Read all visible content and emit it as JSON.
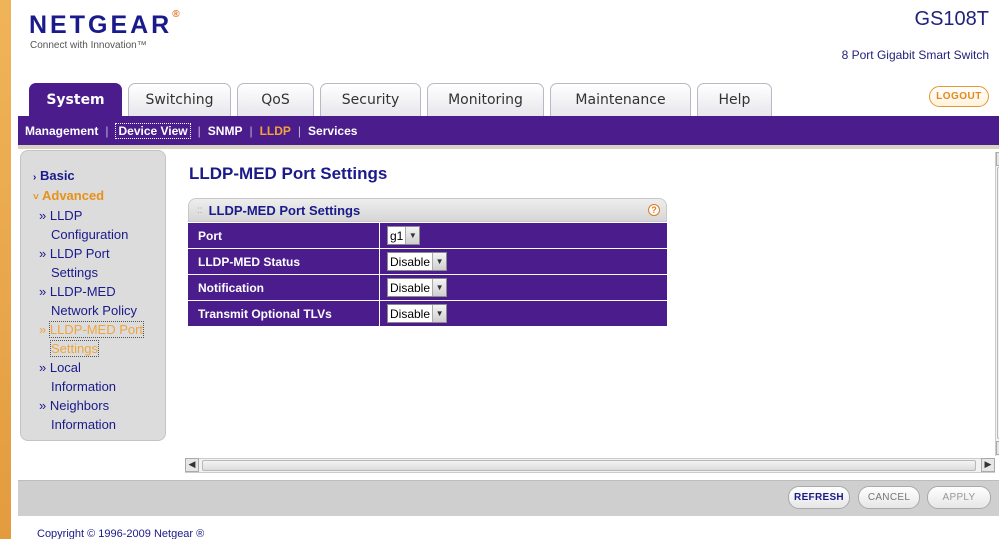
{
  "header": {
    "logo": "NETGEAR",
    "logo_mark": "®",
    "tagline": "Connect with Innovation™",
    "model": "GS108T",
    "model_desc": "8 Port Gigabit Smart Switch",
    "logout": "LOGOUT"
  },
  "tabs": [
    {
      "label": "System",
      "active": true
    },
    {
      "label": "Switching",
      "active": false
    },
    {
      "label": "QoS",
      "active": false
    },
    {
      "label": "Security",
      "active": false
    },
    {
      "label": "Monitoring",
      "active": false
    },
    {
      "label": "Maintenance",
      "active": false
    },
    {
      "label": "Help",
      "active": false
    }
  ],
  "subnav": [
    "Management",
    "Device View",
    "SNMP",
    "LLDP",
    "Services"
  ],
  "sidebar": {
    "basic": "Basic",
    "advanced": "Advanced",
    "items": [
      {
        "line1": "LLDP",
        "line2": "Configuration"
      },
      {
        "line1": "LLDP Port",
        "line2": "Settings"
      },
      {
        "line1": "LLDP-MED",
        "line2": "Network Policy"
      },
      {
        "line1": "LLDP-MED Port",
        "line2": "Settings"
      },
      {
        "line1": "Local",
        "line2": "Information"
      },
      {
        "line1": "Neighbors",
        "line2": "Information"
      }
    ]
  },
  "main": {
    "page_title": "LLDP-MED Port Settings",
    "panel_title": "LLDP-MED Port Settings",
    "rows": [
      {
        "label": "Port",
        "value": "g1"
      },
      {
        "label": "LLDP-MED Status",
        "value": "Disable"
      },
      {
        "label": "Notification",
        "value": "Disable"
      },
      {
        "label": "Transmit Optional TLVs",
        "value": "Disable"
      }
    ]
  },
  "buttons": {
    "refresh": "REFRESH",
    "cancel": "CANCEL",
    "apply": "APPLY"
  },
  "footer": {
    "copyright": "Copyright © 1996-2009 Netgear ®"
  },
  "colors": {
    "brand_purple": "#4b1d8c",
    "accent_orange": "#f3a33a",
    "navy_text": "#1a1a8a"
  }
}
